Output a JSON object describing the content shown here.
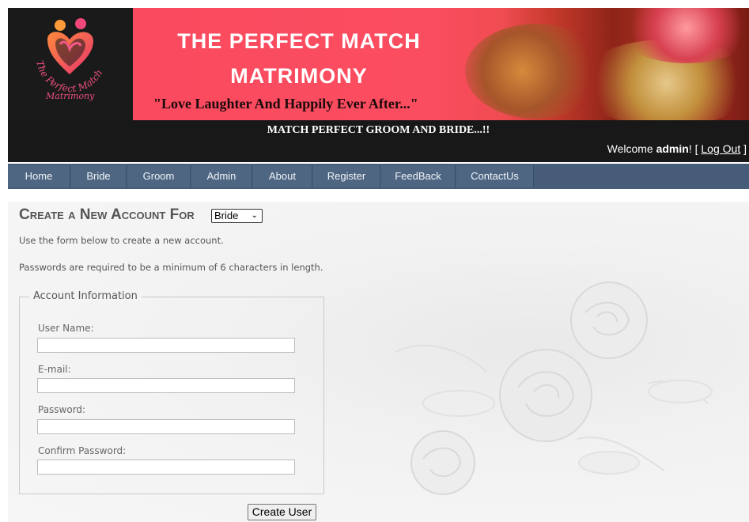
{
  "logo": {
    "arc_text": "The Perfect Match",
    "script_text": "Matrimony"
  },
  "banner": {
    "title_line1": "THE PERFECT MATCH",
    "title_line2": "MATRIMONY",
    "tagline": "\"Love Laughter  And Happily Ever After...\""
  },
  "header": {
    "subtitle": "MATCH PERFECT GROOM AND BRIDE...!!",
    "welcome_prefix": "Welcome ",
    "username": "admin",
    "welcome_mid": "! [ ",
    "logout_label": "Log Out",
    "welcome_suffix": " ]"
  },
  "nav": {
    "items": [
      "Home",
      "Bride",
      "Groom",
      "Admin",
      "About",
      "Register",
      "FeedBack",
      "ContactUs"
    ]
  },
  "form": {
    "heading": "Create a New Account For",
    "account_type_selected": "Bride",
    "intro": "Use the form below to create a new account.",
    "password_note": "Passwords are required to be a minimum of 6 characters in length.",
    "legend": "Account Information",
    "fields": {
      "username": {
        "label": "User Name:",
        "value": ""
      },
      "email": {
        "label": "E-mail:",
        "value": ""
      },
      "password": {
        "label": "Password:",
        "value": ""
      },
      "confirm": {
        "label": "Confirm Password:",
        "value": ""
      }
    },
    "submit_label": "Create User"
  },
  "colors": {
    "banner_red": "#fa4a5f",
    "header_bg": "#181818",
    "nav_bg": "#465c78",
    "logo_pink": "#e94f7b"
  }
}
